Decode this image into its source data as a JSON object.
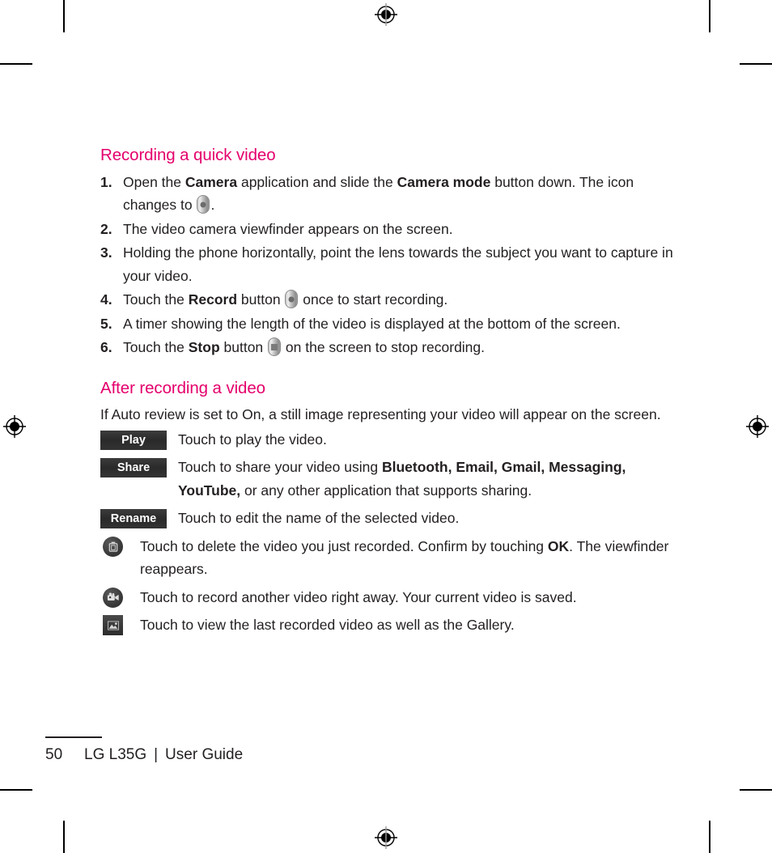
{
  "document": {
    "page_number": "50",
    "footer_title": "LG L35G",
    "footer_separator": "|",
    "footer_subtitle": "User Guide"
  },
  "sections": [
    {
      "heading": "Recording a quick video",
      "steps": [
        {
          "num": "1.",
          "pre": "Open the ",
          "bold1": "Camera",
          "mid": " application and slide the ",
          "bold2": "Camera mode",
          "post": " button down. The icon changes to ",
          "icon": "record-pill-icon",
          "tail": "."
        },
        {
          "num": "2.",
          "text": "The video camera viewfinder appears on the screen."
        },
        {
          "num": "3.",
          "text": "Holding the phone horizontally, point the lens towards the subject you want to capture in your video."
        },
        {
          "num": "4.",
          "pre": "Touch the ",
          "bold1": "Record",
          "mid": " button ",
          "icon": "record-pill-icon",
          "post": " once to start recording.",
          "tail": ""
        },
        {
          "num": "5.",
          "text": "A timer showing the length of the video is displayed at the bottom of the screen."
        },
        {
          "num": "6.",
          "pre": "Touch the ",
          "bold1": "Stop",
          "mid": " button ",
          "icon": "stop-pill-icon",
          "post": " on the screen to stop recording.",
          "tail": ""
        }
      ]
    },
    {
      "heading": "After recording a video",
      "intro": "If Auto review is set to On, a still image representing your video will appear on the screen.",
      "rows": [
        {
          "key_type": "tag",
          "key_label": "Play",
          "key_icon": "play-button-tag",
          "text": "Touch to play the video."
        },
        {
          "key_type": "tag",
          "key_label": "Share",
          "key_icon": "share-button-tag",
          "text_pre": "Touch to share your video using ",
          "text_bold": "Bluetooth, Email, Gmail, Messaging, YouTube,",
          "text_post": " or any other application that supports sharing."
        },
        {
          "key_type": "tag",
          "key_label": "Rename",
          "key_icon": "rename-button-tag",
          "text": "Touch to edit the name of the selected video."
        },
        {
          "key_type": "icon",
          "key_icon": "trash-can-icon",
          "text_pre": "Touch to delete the video you just recorded. Confirm by touching ",
          "text_bold": "OK",
          "text_post": ". The viewfinder reappears."
        },
        {
          "key_type": "icon",
          "key_icon": "video-camera-icon",
          "text": "Touch to record another video right away. Your current video is saved."
        },
        {
          "key_type": "icon",
          "key_icon": "gallery-thumbnail-icon",
          "text": "Touch to view the last recorded video as well as the Gallery."
        }
      ]
    }
  ],
  "colors": {
    "heading_magenta": "#e4006c",
    "body_text": "#231f20",
    "tag_background": "#2d2d2d",
    "tag_text": "#ffffff"
  },
  "print_marks": {
    "registration_marks": [
      "top-center",
      "left-middle",
      "right-middle",
      "bottom-center"
    ],
    "crop_marks": [
      "top-left",
      "top-right",
      "bottom-left",
      "bottom-right"
    ]
  }
}
